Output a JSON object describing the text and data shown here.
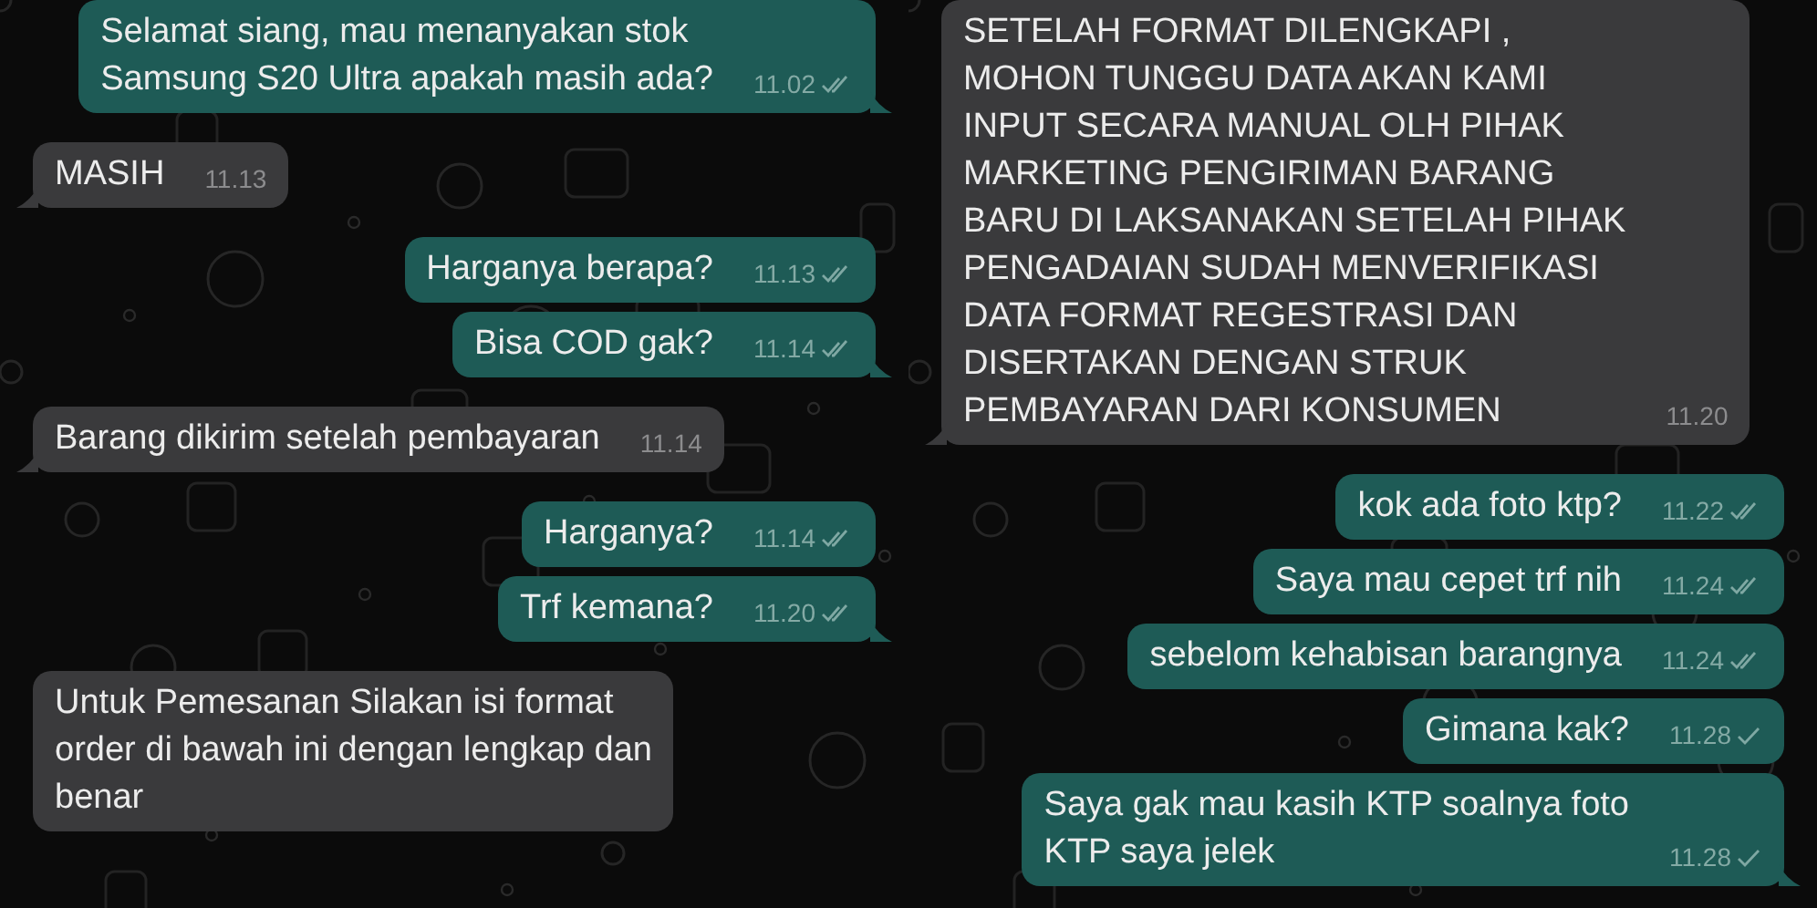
{
  "panels": [
    {
      "messages": [
        {
          "kind": "outgoing",
          "text": "Selamat siang, mau menanyakan stok\nSamsung S20 Ultra apakah masih ada?",
          "time": "11.02",
          "double_check": true,
          "tail": true
        },
        {
          "kind": "incoming",
          "text": "MASIH",
          "time": "11.13",
          "tail": true
        },
        {
          "kind": "outgoing",
          "text": "Harganya berapa?",
          "time": "11.13",
          "double_check": true,
          "tail": false
        },
        {
          "kind": "outgoing",
          "text": "Bisa COD gak?",
          "time": "11.14",
          "double_check": true,
          "tail": true
        },
        {
          "kind": "incoming",
          "text": "Barang dikirim setelah pembayaran",
          "time": "11.14",
          "tail": true
        },
        {
          "kind": "outgoing",
          "text": "Harganya?",
          "time": "11.14",
          "double_check": true,
          "tail": false
        },
        {
          "kind": "outgoing",
          "text": "Trf kemana?",
          "time": "11.20",
          "double_check": true,
          "tail": true
        },
        {
          "kind": "incoming",
          "text": "Untuk Pemesanan Silakan isi format\norder di bawah ini dengan lengkap dan\nbenar",
          "tail": false
        }
      ]
    },
    {
      "messages": [
        {
          "kind": "incoming",
          "text": "SETELAH FORMAT DILENGKAPI ,\nMOHON TUNGGU DATA AKAN KAMI\nINPUT SECARA MANUAL OLH PIHAK\nMARKETING PENGIRIMAN BARANG\nBARU DI LAKSANAKAN SETELAH PIHAK\nPENGADAIAN SUDAH MENVERIFIKASI\nDATA FORMAT REGESTRASI DAN\nDISERTAKAN DENGAN STRUK\nPEMBAYARAN DARI KONSUMEN",
          "time": "11.20",
          "tail": true
        },
        {
          "kind": "outgoing",
          "text": "kok ada foto ktp?",
          "time": "11.22",
          "double_check": true,
          "tail": false
        },
        {
          "kind": "outgoing",
          "text": "Saya mau cepet trf nih",
          "time": "11.24",
          "double_check": true,
          "tail": false
        },
        {
          "kind": "outgoing",
          "text": "sebelom kehabisan barangnya",
          "time": "11.24",
          "double_check": true,
          "tail": false
        },
        {
          "kind": "outgoing",
          "text": "Gimana kak?",
          "time": "11.28",
          "double_check": false,
          "tail": false
        },
        {
          "kind": "outgoing",
          "text": "Saya gak mau kasih KTP soalnya foto\nKTP saya jelek",
          "time": "11.28",
          "double_check": false,
          "tail": true
        }
      ]
    }
  ]
}
